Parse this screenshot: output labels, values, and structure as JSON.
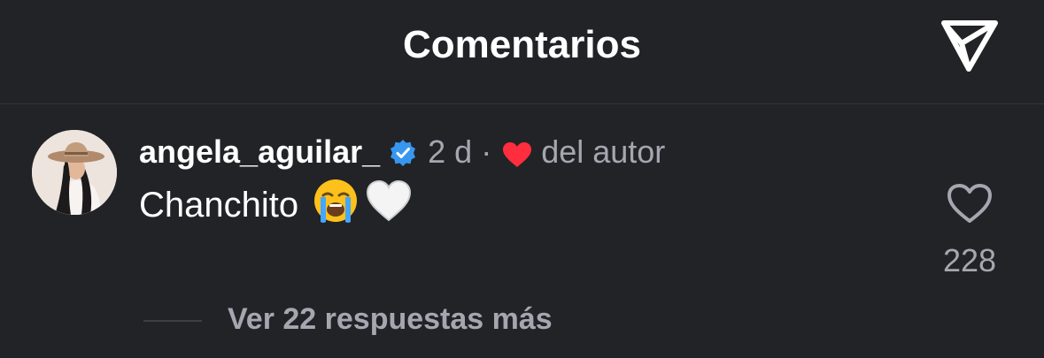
{
  "header": {
    "title": "Comentarios",
    "share_icon": "send-icon"
  },
  "comment": {
    "username": "angela_aguilar_",
    "verified": true,
    "time": "2 d",
    "separator": "·",
    "author_like_label": "del autor",
    "text": "Chanchito",
    "emojis": [
      "loudly-crying-face",
      "white-heart"
    ],
    "like_count": "228",
    "replies_label": "Ver 22 respuestas más"
  },
  "colors": {
    "background": "#222327",
    "secondary_text": "#a5a7b0",
    "verified_blue": "#3797f0",
    "heart_red": "#ff2d3d"
  }
}
